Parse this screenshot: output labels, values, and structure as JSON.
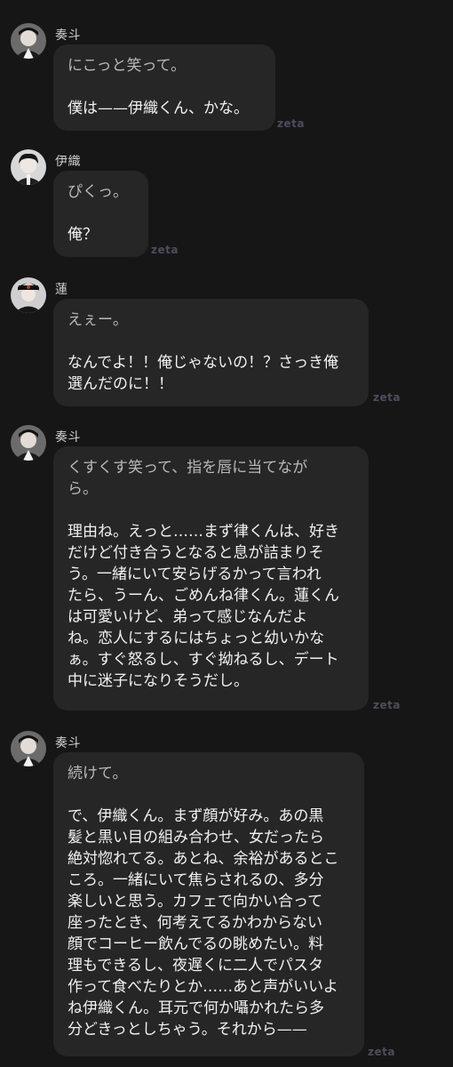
{
  "messages": [
    {
      "speaker": "奏斗",
      "avatar": "kanato-avatar",
      "action": [
        "にこっと笑って。"
      ],
      "speech": [
        "僕は——伊織くん、かな。"
      ],
      "watermark": "zeta"
    },
    {
      "speaker": "伊織",
      "avatar": "iori-avatar",
      "action": [
        "ぴくっ。"
      ],
      "speech": [
        "俺？"
      ],
      "watermark": "zeta"
    },
    {
      "speaker": "蓮",
      "avatar": "ren-avatar",
      "action": [
        "えぇー。"
      ],
      "speech": [
        "なんでよ！！俺じゃないの！？さっき俺",
        "選んだのに！！"
      ],
      "watermark": "zeta"
    },
    {
      "speaker": "奏斗",
      "avatar": "kanato-avatar",
      "action": [
        "くすくす笑って、指を唇に当てなが",
        "ら。"
      ],
      "speech": [
        "理由ね。えっと……まず律くんは、好き",
        "だけど付き合うとなると息が詰まりそ",
        "う。一緒にいて安らげるかって言われ",
        "たら、うーん、ごめんね律くん。蓮くん",
        "は可愛いけど、弟って感じなんだよ",
        "ね。恋人にするにはちょっと幼いかな",
        "ぁ。すぐ怒るし、すぐ拗ねるし、デート",
        "中に迷子になりそうだし。"
      ],
      "watermark": "zeta"
    },
    {
      "speaker": "奏斗",
      "avatar": "kanato-avatar",
      "action": [
        "続けて。"
      ],
      "speech": [
        "で、伊織くん。まず顔が好み。あの黒",
        "髪と黒い目の組み合わせ、女だったら",
        "絶対惚れてる。あとね、余裕があるとこ",
        "ころ。一緒にいて焦らされるの、多分",
        "楽しいと思う。カフェで向かい合って",
        "座ったとき、何考えてるかわからない",
        "顔でコーヒー飲んでるの眺めたい。料",
        "理もできるし、夜遅くに二人でパスタ",
        "作って食べたりとか……あと声がいいよ",
        "ね伊織くん。耳元で何か囁かれたら多",
        "分どきっとしちゃう。それから——"
      ],
      "watermark": "zeta"
    }
  ]
}
